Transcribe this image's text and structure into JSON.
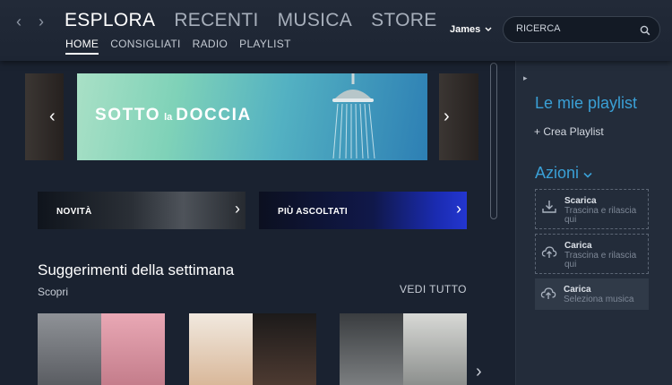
{
  "nav": {
    "back": "‹",
    "forward": "›"
  },
  "main_tabs": [
    {
      "label": "ESPLORA"
    },
    {
      "label": "RECENTI"
    },
    {
      "label": "MUSICA"
    },
    {
      "label": "STORE"
    }
  ],
  "sub_tabs": [
    {
      "label": "HOME"
    },
    {
      "label": "CONSIGLIATI"
    },
    {
      "label": "RADIO"
    },
    {
      "label": "PLAYLIST"
    }
  ],
  "user": {
    "name": "James"
  },
  "search": {
    "placeholder": "RICERCA"
  },
  "carousel": {
    "prev": "‹",
    "next": "›",
    "banner": {
      "title_a": "SOTTO",
      "title_b": "la",
      "title_c": "DOCCIA"
    }
  },
  "categories": [
    {
      "label": "NOVITÀ",
      "arrow": "›"
    },
    {
      "label": "PIÙ ASCOLTATI",
      "arrow": "›"
    }
  ],
  "suggestions": {
    "title": "Suggerimenti della settimana",
    "subtitle": "Scopri",
    "see_all": "VEDI TUTTO",
    "next": "›"
  },
  "sidebar": {
    "collapse": "▸",
    "playlists_heading": "Le mie playlist",
    "create_playlist": "+ Crea Playlist",
    "actions_heading": "Azioni",
    "actions_chevron": "⌄",
    "actions": [
      {
        "title": "Scarica",
        "sub": "Trascina e rilascia qui",
        "icon": "download-icon"
      },
      {
        "title": "Carica",
        "sub": "Trascina e rilascia qui",
        "icon": "upload-cloud-icon"
      },
      {
        "title": "Carica",
        "sub": "Seleziona musica",
        "icon": "upload-cloud-icon"
      }
    ]
  },
  "colors": {
    "accent": "#3aa0d6",
    "background": "#1b2331",
    "topbar": "#222a38"
  }
}
